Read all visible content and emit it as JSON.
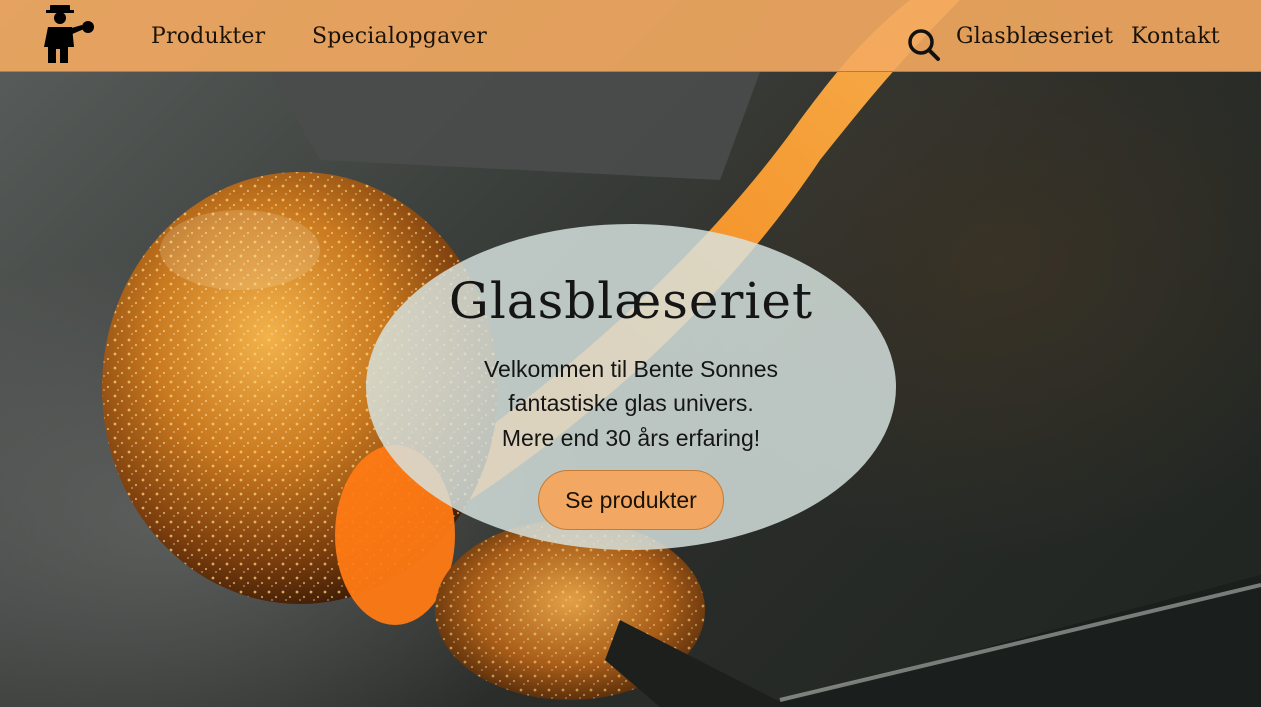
{
  "navbar": {
    "logo_icon": "glassblower-logo-icon",
    "links_left": [
      "Produkter",
      "Specialopgaver"
    ],
    "search_icon": "search-icon",
    "links_right": [
      "Glasblæseriet",
      "Kontakt"
    ],
    "background_color": "#f4aa60"
  },
  "hero": {
    "title": "Glasblæseriet",
    "lines": [
      "Velkommen til Bente Sonnes",
      "fantastiske glas univers.",
      "Mere end 30 års erfaring!"
    ],
    "button_label": "Se produkter",
    "button_color": "#f2a863",
    "background_image": "glass-blowing-photo"
  }
}
